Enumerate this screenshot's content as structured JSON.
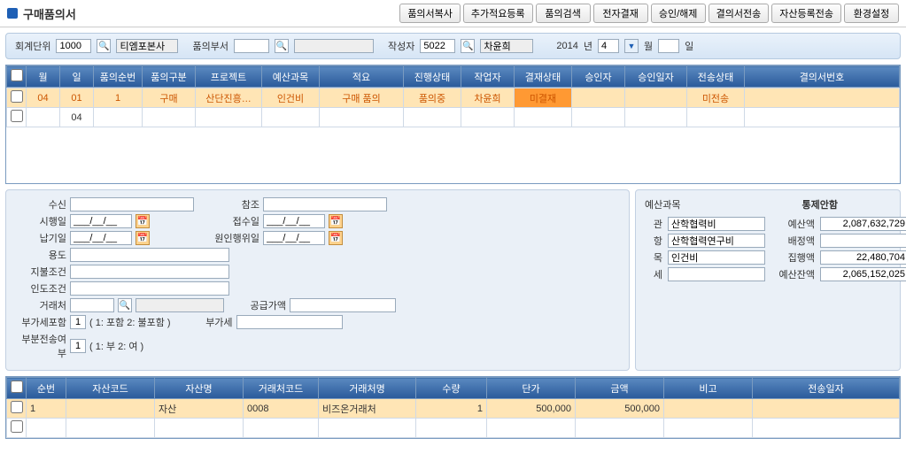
{
  "header": {
    "title": "구매품의서",
    "buttons": [
      "품의서복사",
      "추가적요등록",
      "품의검색",
      "전자결재",
      "승인/해제",
      "결의서전송",
      "자산등록전송",
      "환경설정"
    ]
  },
  "filter": {
    "unit_label": "회계단위",
    "unit_code": "1000",
    "unit_name": "티엠포본사",
    "dept_label": "품의부서",
    "dept_code": "",
    "dept_name": "",
    "author_label": "작성자",
    "author_code": "5022",
    "author_name": "차윤희",
    "year": "2014",
    "year_suffix": "년",
    "month": "4",
    "month_suffix": "월",
    "day": "",
    "day_suffix": "일"
  },
  "main_grid": {
    "headers": [
      "월",
      "일",
      "품의순번",
      "품의구분",
      "프로젝트",
      "예산과목",
      "적요",
      "진행상태",
      "작업자",
      "결재상태",
      "승인자",
      "승인일자",
      "전송상태",
      "결의서번호"
    ],
    "rows": [
      {
        "cells": [
          "04",
          "01",
          "1",
          "구매",
          "산단진흥…",
          "인건비",
          "구매 품의",
          "품의중",
          "차윤희",
          "미결재",
          "",
          "",
          "미전송",
          ""
        ],
        "selected": true
      },
      {
        "cells": [
          "",
          "04",
          "",
          "",
          "",
          "",
          "",
          "",
          "",
          "",
          "",
          "",
          "",
          ""
        ],
        "selected": false
      }
    ]
  },
  "detail": {
    "labels": {
      "susin": "수신",
      "chamjo": "참조",
      "sihaeng": "시행일",
      "jeopsu": "접수일",
      "napgi": "납기일",
      "wonin": "원인행위일",
      "yongdo": "용도",
      "jibul": "지불조건",
      "indo": "인도조건",
      "georae": "거래처",
      "gonggeup": "공급가액",
      "vat_label": "부가세포함",
      "vat_hint": "( 1: 포함  2: 불포함 )",
      "vat": "부가세",
      "partial_label": "부분전송여부",
      "partial_hint": "( 1: 부  2: 여 )"
    },
    "values": {
      "susin": "",
      "chamjo": "",
      "sihaeng": "___/__/__",
      "jeopsu": "___/__/__",
      "napgi": "___/__/__",
      "wonin": "___/__/__",
      "yongdo": "",
      "jibul": "",
      "indo": "",
      "georae_code": "",
      "georae_name": "",
      "gonggeup": "",
      "vat_include": "1",
      "vat": "",
      "partial": "1"
    }
  },
  "budget": {
    "title": "예산과목",
    "control": "통제안함",
    "labels": {
      "gwan": "관",
      "hang": "항",
      "mok": "목",
      "se": "세",
      "yesan": "예산액",
      "baejeong": "배정액",
      "jiphaeng": "집행액",
      "janek": "예산잔액"
    },
    "values": {
      "gwan": "산학협력비",
      "hang": "산학협력연구비",
      "mok": "인건비",
      "se": "",
      "yesan": "2,087,632,729",
      "baejeong": "",
      "jiphaeng": "22,480,704",
      "janek": "2,065,152,025"
    }
  },
  "bottom_grid": {
    "headers": [
      "순번",
      "자산코드",
      "자산명",
      "거래처코드",
      "거래처명",
      "수량",
      "단가",
      "금액",
      "비고",
      "전송일자"
    ],
    "rows": [
      {
        "cells": [
          "1",
          "",
          "자산",
          "0008",
          "비즈온거래처",
          "1",
          "500,000",
          "500,000",
          "",
          ""
        ],
        "selected": true
      },
      {
        "cells": [
          "",
          "",
          "",
          "",
          "",
          "",
          "",
          "",
          "",
          ""
        ],
        "selected": false
      }
    ]
  }
}
